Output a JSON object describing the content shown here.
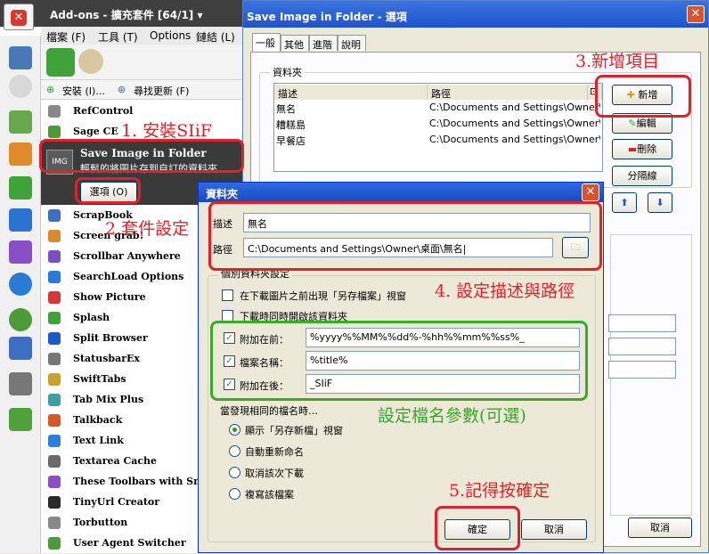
{
  "addons": {
    "title": "Add-ons - 擴充套件 [64/1] ▾",
    "menu": [
      "檔案 (F)",
      "工具 (T)",
      "Options",
      "鏈結 (L)"
    ],
    "install_label": "安裝 (I)...",
    "update_label": "尋找更新 (F)",
    "items_top": [
      "RefControl",
      "Sage CE"
    ],
    "selected": {
      "name": "Save Image in Folder",
      "desc": "輕鬆的將圖片存到自訂的資料夾",
      "options_label": "選項 (O)"
    },
    "items": [
      "ScrapBook",
      "Screen grab!",
      "Scrollbar Anywhere",
      "SearchLoad Options",
      "Show Picture",
      "Splash",
      "Split Browser",
      "StatusbarEx",
      "SwiftTabs",
      "Tab Mix Plus",
      "Talkback",
      "Text Link",
      "Textarea Cache",
      "These Toolbars with Sma",
      "TinyUrl Creator",
      "Torbutton",
      "User Agent Switcher"
    ]
  },
  "sif": {
    "title": "Save Image in Folder - 選項",
    "tabs": [
      "一般",
      "其他",
      "進階",
      "說明"
    ],
    "group": "資料夾",
    "col_desc": "描述",
    "col_path": "路徑",
    "rows": [
      {
        "desc": "無名",
        "path": "C:\\Documents and Settings\\Owner\\"
      },
      {
        "desc": "糟糕島",
        "path": "C:\\Documents and Settings\\Owner\\"
      },
      {
        "desc": "早餐店",
        "path": "C:\\Documents and Settings\\Owner\\"
      }
    ],
    "btn_add": "新增",
    "btn_edit": "編輯",
    "btn_delete": "刪除",
    "btn_separator": "分隔線",
    "btn_cancel": "取消"
  },
  "folder": {
    "title": "資料夾",
    "desc_label": "描述",
    "desc_value": "無名",
    "path_label": "路徑",
    "path_value": "C:\\Documents and Settings\\Owner\\桌面\\無名|",
    "section": "個別資料夾設定",
    "check1": "在下載圖片之前出現「另存檔案」視窗",
    "check2": "下載時同時開啟該資料夾",
    "prefix_label": "附加在前：",
    "prefix_value": "%yyyy%%MM%%dd%-%hh%%mm%%ss%_",
    "name_label": "檔案名稱：",
    "name_value": "%title%",
    "suffix_label": "附加在後：",
    "suffix_value": "_SIiF",
    "same_name_label": "當發現相同的檔名時…",
    "radios": [
      "顯示「另存新檔」視窗",
      "自動重新命名",
      "取消該次下載",
      "複寫該檔案"
    ],
    "ok": "確定",
    "cancel": "取消"
  },
  "annotations": {
    "a1": "1. 安裝SIiF",
    "a2": "2.套件設定",
    "a3": "3.新增項目",
    "a4": "4. 設定描述與路徑",
    "a5": "設定檔名參數(可選)",
    "a6": "5.記得按確定"
  },
  "colors": {
    "annotation_red": "#e0202a",
    "annotation_green": "#3aaa2c",
    "xp_blue": "#2f6ae2"
  }
}
